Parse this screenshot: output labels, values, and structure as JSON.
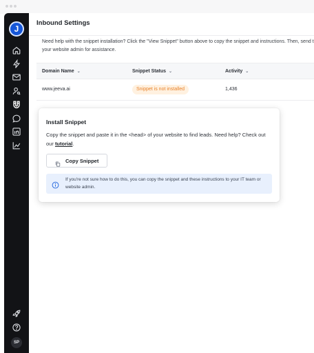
{
  "sidebar": {
    "logo_letter": "J",
    "avatar_initials": "SP",
    "items": [
      {
        "icon": "home-icon"
      },
      {
        "icon": "lightning-icon"
      },
      {
        "icon": "mail-icon"
      },
      {
        "icon": "user-search-icon"
      },
      {
        "icon": "magnet-icon"
      },
      {
        "icon": "chat-icon"
      },
      {
        "icon": "linkedin-icon"
      },
      {
        "icon": "analytics-icon"
      }
    ],
    "bottom_items": [
      {
        "icon": "rocket-icon"
      },
      {
        "icon": "help-icon"
      }
    ]
  },
  "header": {
    "title": "Inbound Settings"
  },
  "help": {
    "text": "Need help with the snippet installation? Click the \"View Snippet\" button above to copy the snippet and instructions. Then, send them to your website admin for assistance."
  },
  "table": {
    "columns": [
      "Domain Name",
      "Snippet Status",
      "Activity"
    ],
    "rows": [
      {
        "domain": "www.jeeva.ai",
        "status": "Snippet is not installed",
        "activity": "1,436"
      }
    ]
  },
  "popover": {
    "title": "Install Snippet",
    "body_text": "Copy the snippet and paste it in the <head> of your website to find leads. Need help? Check out our",
    "link_text": "tutorial",
    "body_end": ".",
    "copy_button": "Copy Snippet",
    "info_text": "If you're not sure how to do this, you can copy the snippet and these instructions to your IT team or website admin."
  },
  "colors": {
    "sidebar_bg": "#121316",
    "accent": "#1556d8",
    "status_warning_text": "#e8822a",
    "status_warning_bg": "#fff1e0",
    "info_bg": "#e8f0fd"
  }
}
